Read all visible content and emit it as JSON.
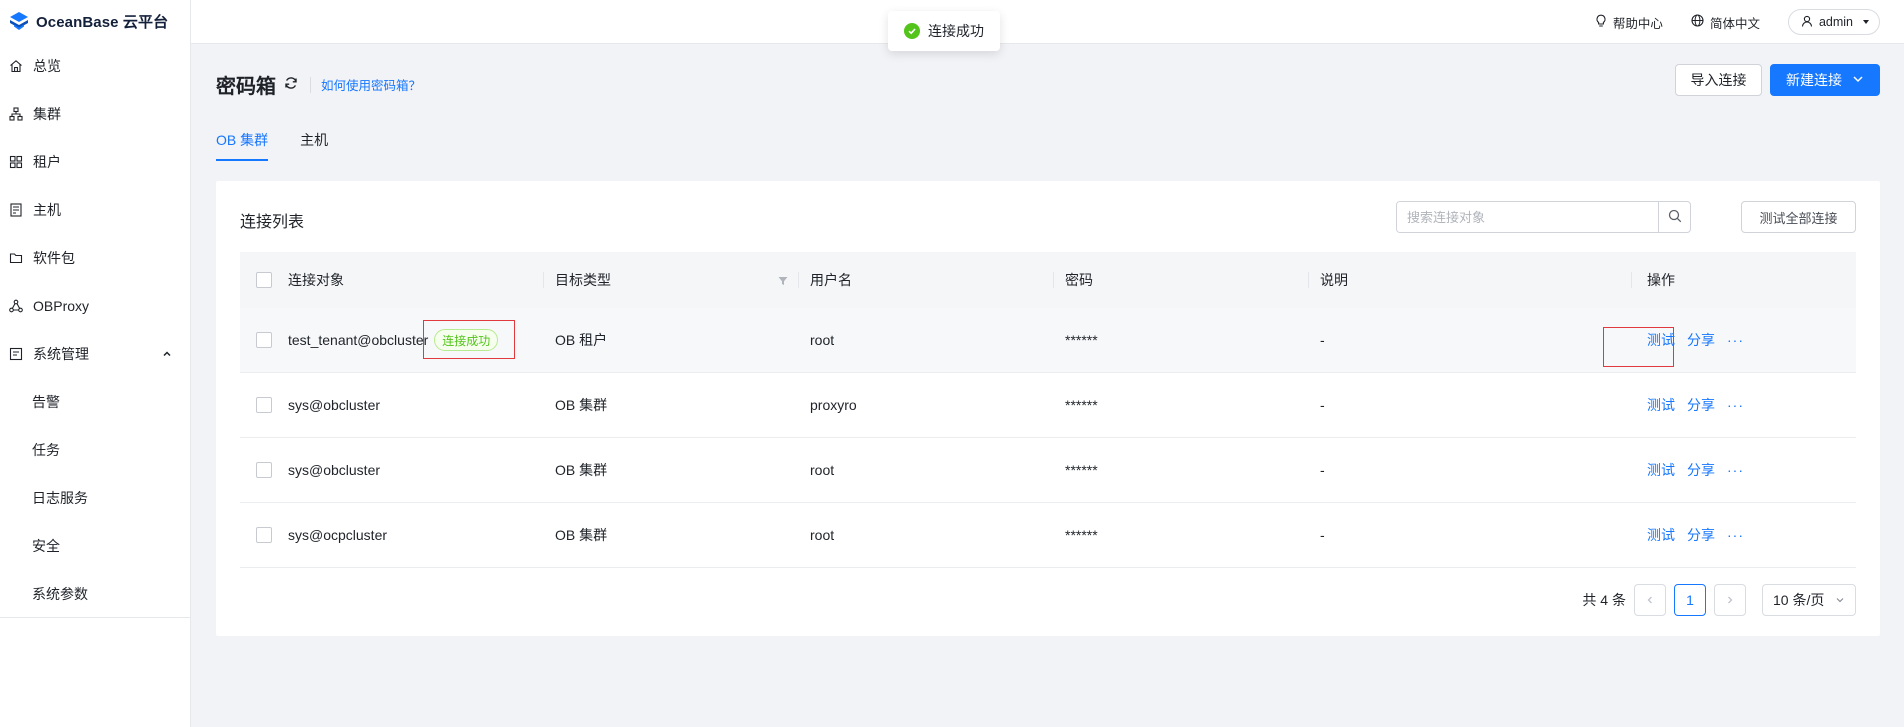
{
  "app": {
    "brand": "OceanBase 云平台"
  },
  "sidebar": {
    "items": [
      {
        "label": "总览",
        "icon": "home-icon"
      },
      {
        "label": "集群",
        "icon": "cluster-icon"
      },
      {
        "label": "租户",
        "icon": "tenant-icon"
      },
      {
        "label": "主机",
        "icon": "host-icon"
      },
      {
        "label": "软件包",
        "icon": "folder-icon"
      },
      {
        "label": "OBProxy",
        "icon": "proxy-icon"
      },
      {
        "label": "系统管理",
        "icon": "system-icon"
      }
    ],
    "sub_items": [
      "告警",
      "任务",
      "日志服务",
      "安全",
      "系统参数"
    ]
  },
  "header": {
    "help": "帮助中心",
    "language": "简体中文",
    "user": "admin"
  },
  "toast": {
    "message": "连接成功"
  },
  "page": {
    "title": "密码箱",
    "help_link": "如何使用密码箱？",
    "import_label": "导入连接",
    "new_label": "新建连接"
  },
  "tabs": [
    {
      "label": "OB 集群",
      "active": true
    },
    {
      "label": "主机",
      "active": false
    }
  ],
  "card": {
    "title": "连接列表",
    "search_placeholder": "搜索连接对象",
    "test_all_label": "测试全部连接"
  },
  "table": {
    "columns": [
      "连接对象",
      "目标类型",
      "用户名",
      "密码",
      "说明",
      "操作"
    ],
    "rows": [
      {
        "object": "test_tenant@obcluster",
        "badge": "连接成功",
        "type": "OB 租户",
        "user": "root",
        "password": "******",
        "desc": "-"
      },
      {
        "object": "sys@obcluster",
        "badge": "",
        "type": "OB 集群",
        "user": "proxyro",
        "password": "******",
        "desc": "-"
      },
      {
        "object": "sys@obcluster",
        "badge": "",
        "type": "OB 集群",
        "user": "root",
        "password": "******",
        "desc": "-"
      },
      {
        "object": "sys@ocpcluster",
        "badge": "",
        "type": "OB 集群",
        "user": "root",
        "password": "******",
        "desc": "-"
      }
    ],
    "actions": {
      "test": "测试",
      "share": "分享",
      "more": "···"
    }
  },
  "pagination": {
    "total": "共 4 条",
    "current": "1",
    "page_size": "10 条/页"
  },
  "colors": {
    "primary": "#1677ff",
    "success": "#52c41a",
    "annotation": "#e0393e"
  }
}
